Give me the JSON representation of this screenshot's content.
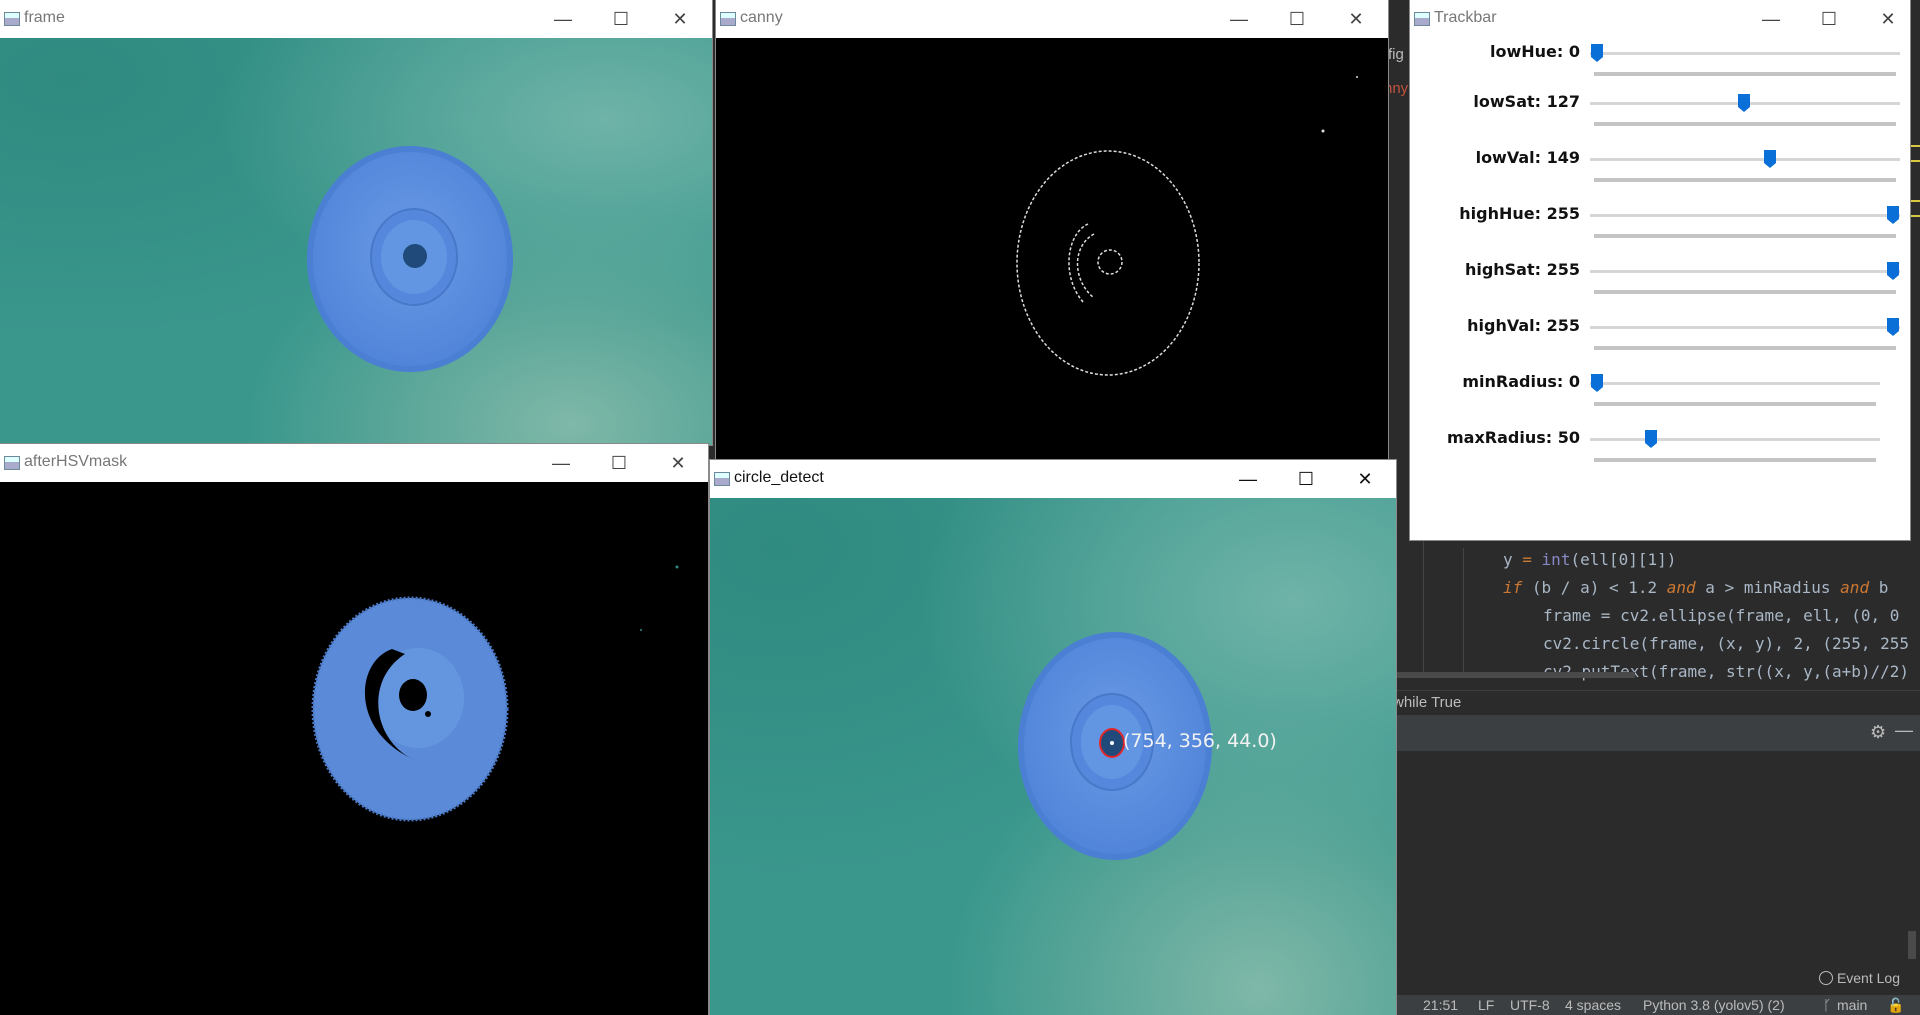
{
  "windows": {
    "frame": {
      "title": "frame"
    },
    "canny": {
      "title": "canny"
    },
    "trackbar": {
      "title": "Trackbar"
    },
    "hsv": {
      "title": "afterHSVmask"
    },
    "circle": {
      "title": "circle_detect"
    }
  },
  "trackbar": {
    "sliders": [
      {
        "label": "lowHue: 0",
        "value": 0,
        "max": 255
      },
      {
        "label": "lowSat: 127",
        "value": 127,
        "max": 255
      },
      {
        "label": "lowVal: 149",
        "value": 149,
        "max": 255
      },
      {
        "label": "highHue: 255",
        "value": 255,
        "max": 255
      },
      {
        "label": "highSat: 255",
        "value": 255,
        "max": 255
      },
      {
        "label": "highVal: 255",
        "value": 255,
        "max": 255
      },
      {
        "label": "minRadius: 0",
        "value": 0,
        "max": 255
      },
      {
        "label": "maxRadius: 50",
        "value": 50,
        "max": 255
      }
    ]
  },
  "detection": {
    "annotation": "(754, 356, 44.0)"
  },
  "ide": {
    "tab_fig": "fig",
    "tab_canny": "nny",
    "code": {
      "line1_var": "y",
      "line1_rest": " = ",
      "line1_fn": "int",
      "line1_args": "(ell[0][1])",
      "line2_kw": "if",
      "line2_rest": " (b / a) < 1.2 ",
      "line2_and": "and",
      "line2_mid": " a > minRadius ",
      "line2_and2": "and",
      "line2_end": " b ",
      "line3": "frame = cv2.ellipse(frame, ell, (0, 0",
      "line4": "cv2.circle(frame, (x, y), 2, (255, 255",
      "line5": "cv2.putText(frame, str((x, y,(a+b)//2)"
    },
    "breadcrumb": "while True",
    "event_log": "Event Log",
    "status": {
      "time": "21:51",
      "line_sep": "LF",
      "encoding": "UTF-8",
      "indent": "4 spaces",
      "interpreter": "Python 3.8 (yolov5) (2)",
      "branch": "main"
    }
  },
  "colors": {
    "slider_thumb": "#0a6fd6",
    "object_blue": "#5b8ee0",
    "teal": "#3a978c"
  },
  "icons": [
    "minimize-icon",
    "maximize-icon",
    "close-icon",
    "gear-icon",
    "hide-icon",
    "branch-icon",
    "lock-icon",
    "event-log-icon"
  ]
}
